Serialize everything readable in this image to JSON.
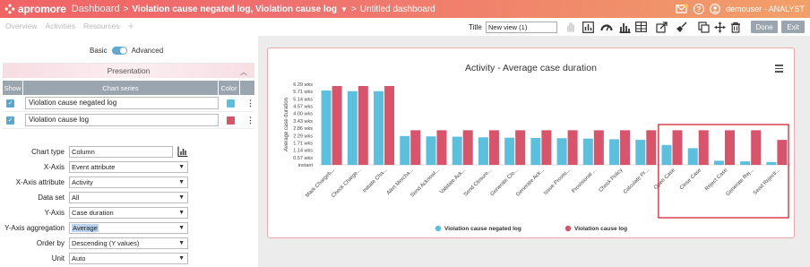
{
  "topbar": {
    "brand": "apromore",
    "app": "Dashboard",
    "logs": "Violation cause negated log, Violation cause log",
    "dashboard": "Untitled dashboard",
    "user": "demouser - ANALYST",
    "help_icon": "?"
  },
  "menu": {
    "items": [
      "Overview",
      "Activities",
      "Resources"
    ],
    "add": "+"
  },
  "toolbar": {
    "title_label": "Title",
    "title_value": "New view (1)",
    "done": "Done",
    "exit": "Exit",
    "icons": [
      "palm-icon",
      "bar-chart-icon",
      "gauge-icon",
      "histogram-icon",
      "table-icon",
      "export-icon",
      "broom-icon",
      "copy-icon",
      "move-icon",
      "trash-icon"
    ]
  },
  "left": {
    "basic": "Basic",
    "advanced": "Advanced",
    "presentation": "Presentation",
    "table_headers": [
      "Show",
      "Chart series",
      "Color"
    ],
    "series": [
      {
        "name": "Violation cause negated log",
        "color": "#5bc0de"
      },
      {
        "name": "Violation cause log",
        "color": "#d9536a"
      }
    ],
    "form": {
      "chart_type_label": "Chart type",
      "chart_type": "Column",
      "xaxis_label": "X-Axis",
      "xaxis": "Event attribute",
      "xattr_label": "X-Axis attribute",
      "xattr": "Activity",
      "dataset_label": "Data set",
      "dataset": "All",
      "yaxis_label": "Y-Axis",
      "yaxis": "Case duration",
      "yagg_label": "Y-Axis aggregation",
      "yagg": "Average",
      "order_label": "Order by",
      "order": "Descending (Y values)",
      "unit_label": "Unit",
      "unit": "Auto"
    }
  },
  "chart_data": {
    "type": "bar",
    "title": "Activity - Average case duration",
    "ylabel": "Average case duration",
    "xlabel": "",
    "yticks": [
      "instant",
      "0.57 wks",
      "1.14 wks",
      "1.71 wks",
      "2.29 wks",
      "2.86 wks",
      "3.43 wks",
      "4.00 wks",
      "4.57 wks",
      "5.14 wks",
      "5.71 wks",
      "6.29 wks"
    ],
    "ylim": [
      0,
      6.29
    ],
    "categories": [
      "Mark Chargeb...",
      "Check Charge...",
      "Initiate Cha...",
      "Alert Mercha...",
      "Send Acknowl...",
      "Validate Ack...",
      "Send Closure...",
      "Generate Clo...",
      "Generate Ack...",
      "Issue Provisi...",
      "Provisional ...",
      "Check Policy",
      "Calculate Pr...",
      "Open Case",
      "Close Case",
      "Reject Case",
      "Generate Rej...",
      "Send Rejecti..."
    ],
    "series": [
      {
        "name": "Violation cause negated log",
        "color": "#5bc0de",
        "values": [
          5.8,
          5.75,
          5.75,
          2.25,
          2.22,
          2.2,
          2.15,
          2.12,
          2.1,
          2.08,
          2.05,
          2.0,
          1.95,
          1.55,
          1.3,
          0.32,
          0.27,
          0.22
        ]
      },
      {
        "name": "Violation cause log",
        "color": "#d9536a",
        "values": [
          6.15,
          6.15,
          6.15,
          2.7,
          2.7,
          2.7,
          2.7,
          2.7,
          2.7,
          2.7,
          2.7,
          2.7,
          2.7,
          2.7,
          2.7,
          2.7,
          2.7,
          1.95
        ]
      }
    ],
    "legend": "bottom-center",
    "highlight": "last five categories outlined in red"
  }
}
